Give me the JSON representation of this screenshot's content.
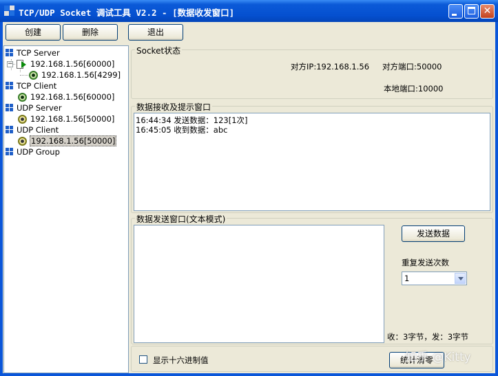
{
  "window": {
    "title": "TCP/UDP Socket 调试工具 V2.2 - [数据收发窗口]"
  },
  "toolbar": {
    "create_label": "创建",
    "delete_label": "删除",
    "exit_label": "退出"
  },
  "tree": {
    "tcp_server": "TCP Server",
    "tcp_server_item": "192.168.1.56[60000]",
    "tcp_server_child": "192.168.1.56[4299]",
    "tcp_client": "TCP Client",
    "tcp_client_item": "192.168.1.56[60000]",
    "udp_server": "UDP Server",
    "udp_server_item": "192.168.1.56[50000]",
    "udp_client": "UDP Client",
    "udp_client_item": "192.168.1.56[50000]",
    "udp_group": "UDP Group"
  },
  "socket_status": {
    "label": "Socket状态",
    "remote_ip": "对方IP:192.168.1.56",
    "remote_port": "对方端口:50000",
    "local_port": "本地端口:10000"
  },
  "receive": {
    "label": "数据接收及提示窗口",
    "lines": [
      "16:44:34 发送数据：123[1次]",
      "16:45:05 收到数据：abc"
    ]
  },
  "send": {
    "label": "数据发送窗口(文本模式)",
    "send_button": "发送数据",
    "repeat_label": "重复发送次数",
    "repeat_value": "1",
    "stats": "收：3字节，发：3字节"
  },
  "bottom": {
    "hex_label": "显示十六进制值",
    "clear_button": "统计清零"
  },
  "watermark": "知乎 @Kitty"
}
